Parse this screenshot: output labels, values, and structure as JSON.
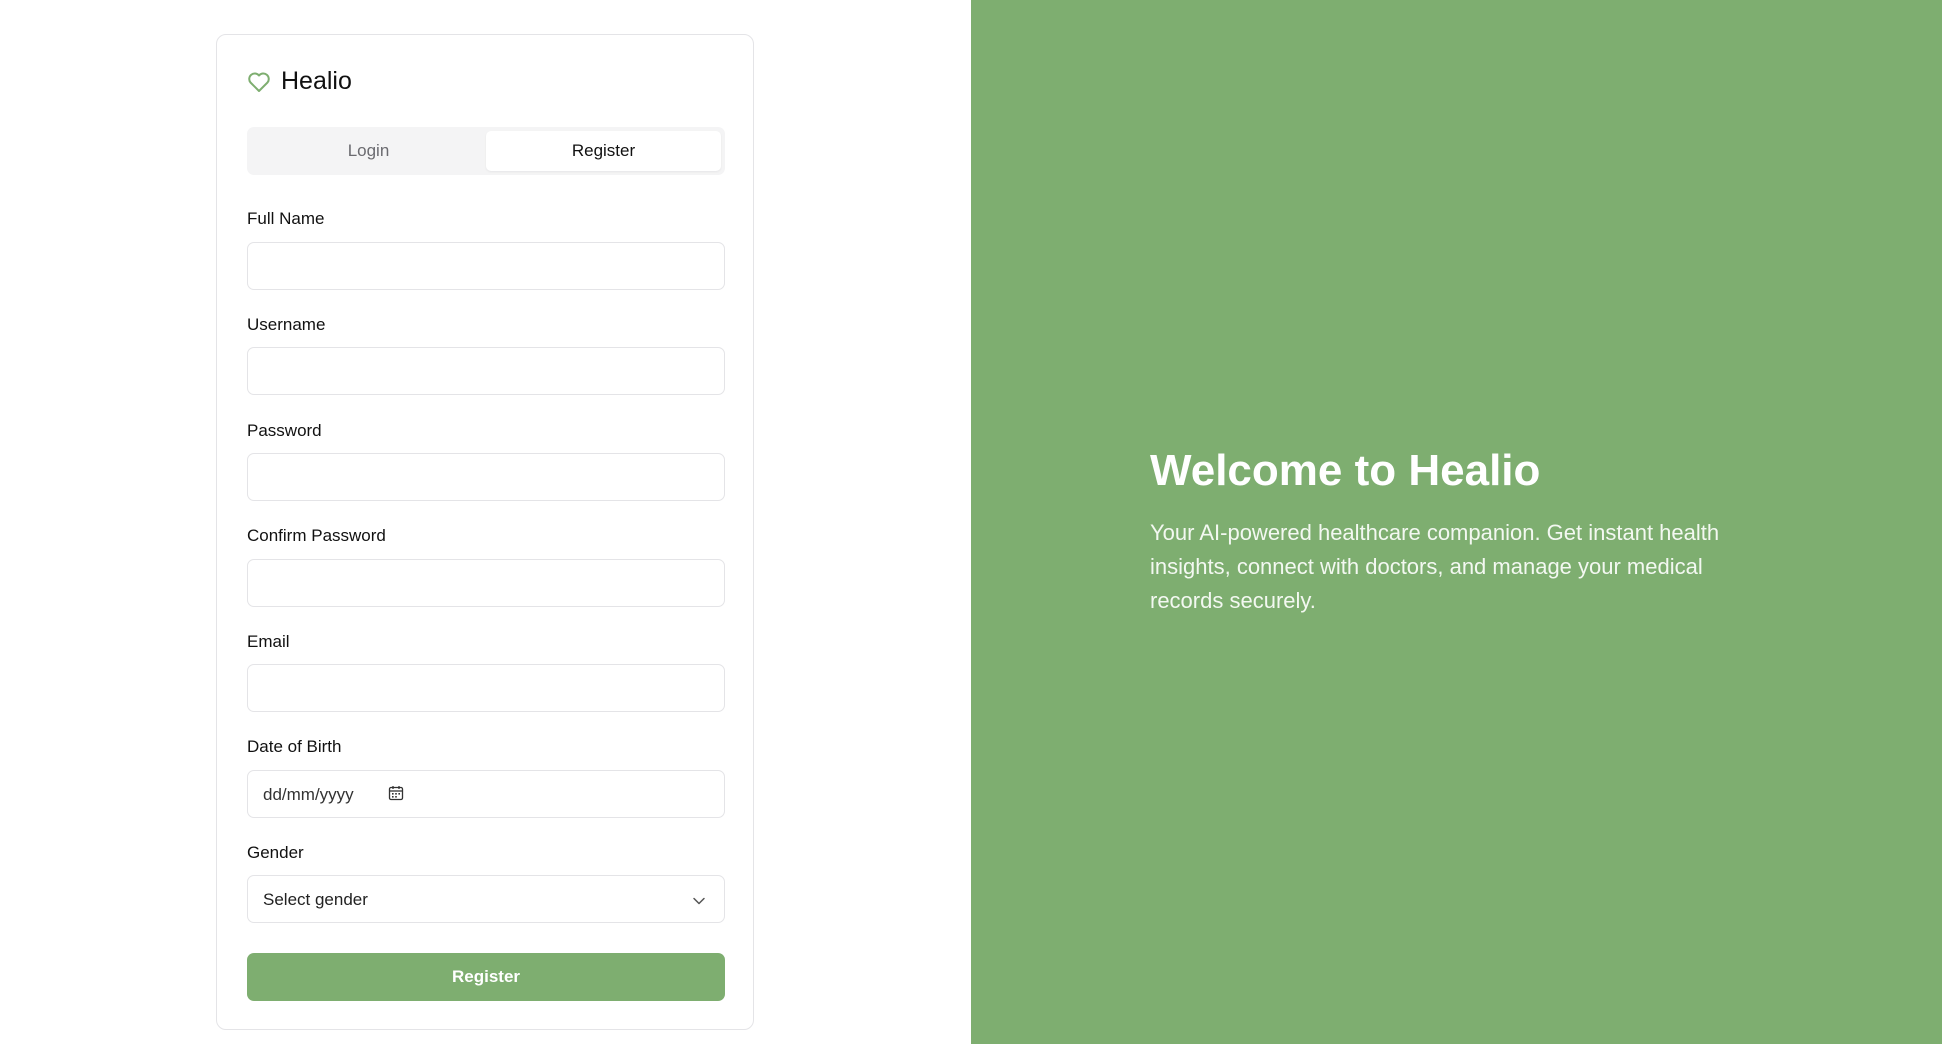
{
  "brand": {
    "name": "Healio",
    "icon": "heart-icon",
    "accent_color": "#7eae70"
  },
  "tabs": [
    {
      "label": "Login",
      "active": false
    },
    {
      "label": "Register",
      "active": true
    }
  ],
  "form": {
    "full_name": {
      "label": "Full Name",
      "value": ""
    },
    "username": {
      "label": "Username",
      "value": ""
    },
    "password": {
      "label": "Password",
      "value": ""
    },
    "confirm_password": {
      "label": "Confirm Password",
      "value": ""
    },
    "email": {
      "label": "Email",
      "value": ""
    },
    "dob": {
      "label": "Date of Birth",
      "placeholder": "dd/mm/yyyy"
    },
    "gender": {
      "label": "Gender",
      "selected": "Select gender"
    },
    "submit_label": "Register"
  },
  "hero": {
    "title": "Welcome to Healio",
    "subtitle": "Your AI-powered healthcare companion. Get instant health insights, connect with doctors, and manage your medical records securely.",
    "background_color": "#7eae70"
  }
}
